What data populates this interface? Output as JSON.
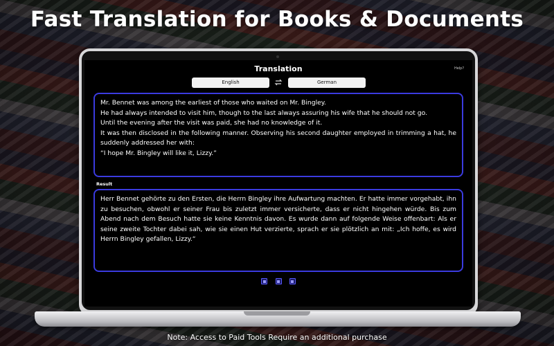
{
  "headline": "Fast Translation for Books & Documents",
  "app": {
    "title": "Translation",
    "help_label": "Help?",
    "source_language": "English",
    "target_language": "German",
    "source_paragraphs": [
      "Mr. Bennet was among the earliest of those who waited on Mr. Bingley.",
      "He had always intended to visit him, though to the last always assuring his wife that he should not go.",
      "Until the evening after the visit was paid, she had no knowledge of it.",
      "It was then disclosed in the following manner. Observing his second daughter employed in trimming a hat, he suddenly addressed her with:",
      "“I hope Mr. Bingley will like it, Lizzy.”"
    ],
    "result_label": "Result",
    "result_text": "Herr Bennet gehörte zu den Ersten, die Herrn Bingley ihre Aufwartung machten. Er hatte immer vorgehabt, ihn zu besuchen, obwohl er seiner Frau bis zuletzt immer versicherte, dass er nicht hingehen würde. Bis zum Abend nach dem Besuch hatte sie keine Kenntnis davon. Es wurde dann auf folgende Weise offenbart: Als er seine zweite Tochter dabei sah, wie sie einen Hut verzierte, sprach er sie plötzlich an mit: „Ich hoffe, es wird Herrn Bingley gefallen, Lizzy.“",
    "tool_icons": [
      "copy-icon",
      "speaker-icon",
      "share-icon"
    ],
    "accent_color": "#3b3be0"
  },
  "footer_note": "Note: Access to Paid Tools Require an additional purchase"
}
